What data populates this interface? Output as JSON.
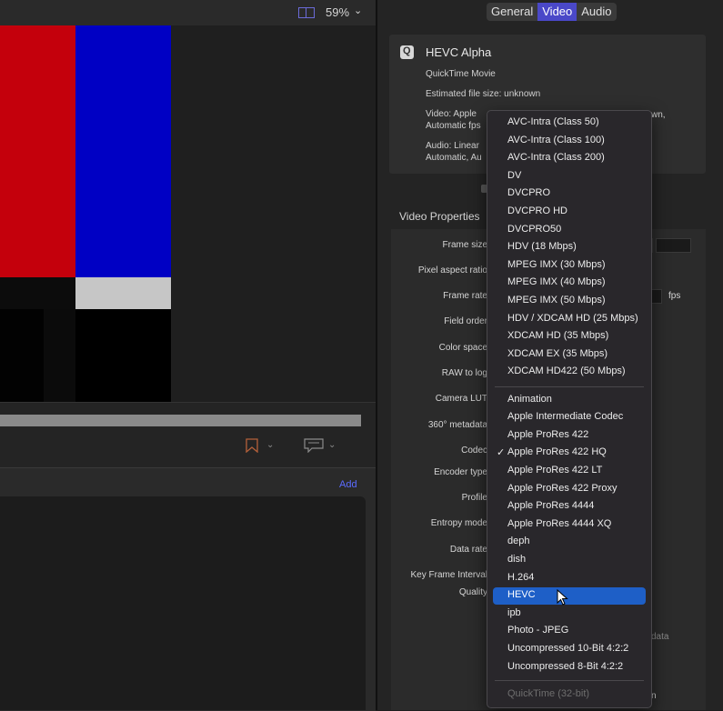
{
  "viewer": {
    "zoom_label": "59%",
    "zoom_chevron": "⌄",
    "add_label": "Add",
    "chev_glyph": "⌄"
  },
  "icons": {
    "zoom": "viewer-layout-icon",
    "bookmark": "bookmark-icon",
    "comment": "comment-icon",
    "app": "quicktime-icon",
    "cursor": "pointer-cursor-icon"
  },
  "colors": {
    "accent": "#4a48c8",
    "highlight": "#1e5fc7",
    "bar_red": "#c4000c",
    "bar_blue": "#0000c4",
    "link": "#5b6bff"
  },
  "tabs": [
    {
      "label": "General",
      "active": false
    },
    {
      "label": "Video",
      "active": true
    },
    {
      "label": "Audio",
      "active": false
    }
  ],
  "summary": {
    "title": "HEVC Alpha",
    "format": "QuickTime Movie",
    "file_size": "Estimated file size: unknown",
    "video_line1": "Video: Apple",
    "video_line1_tail": "wn,",
    "video_line2": "Automatic fps",
    "audio_line1": "Audio: Linear",
    "audio_line2": "Automatic, Au"
  },
  "video_properties": {
    "header": "Video Properties",
    "labels": {
      "frame_size": "Frame size",
      "pixel_aspect": "Pixel aspect ratio",
      "frame_rate": "Frame rate",
      "field_order": "Field order",
      "color_space": "Color space",
      "raw_to_log": "RAW to log",
      "camera_lut": "Camera LUT",
      "metadata_360": "360° metadata",
      "codec": "Codec",
      "encoder_type": "Encoder type",
      "profile": "Profile",
      "entropy_mode": "Entropy mode",
      "data_rate": "Data rate",
      "key_frame": "Key Frame Interval",
      "quality": "Quality"
    },
    "fps_unit": "fps",
    "data_tail": "data",
    "n_tail": "n"
  },
  "codec_menu": {
    "group1": [
      "AVC-Intra (Class 50)",
      "AVC-Intra (Class 100)",
      "AVC-Intra (Class 200)",
      "DV",
      "DVCPRO",
      "DVCPRO HD",
      "DVCPRO50",
      "HDV (18 Mbps)",
      "MPEG IMX (30 Mbps)",
      "MPEG IMX (40 Mbps)",
      "MPEG IMX (50 Mbps)",
      "HDV / XDCAM HD (25 Mbps)",
      "XDCAM HD (35 Mbps)",
      "XDCAM EX (35 Mbps)",
      "XDCAM HD422 (50 Mbps)"
    ],
    "group2": [
      "Animation",
      "Apple Intermediate Codec",
      "Apple ProRes 422",
      "Apple ProRes 422 HQ",
      "Apple ProRes 422 LT",
      "Apple ProRes 422 Proxy",
      "Apple ProRes 4444",
      "Apple ProRes 4444 XQ",
      "deph",
      "dish",
      "H.264",
      "HEVC",
      "ipb",
      "Photo - JPEG",
      "Uncompressed 10-Bit 4:2:2",
      "Uncompressed 8-Bit 4:2:2"
    ],
    "checked_item": "Apple ProRes 422 HQ",
    "check_glyph": "✓",
    "highlighted_item": "HEVC",
    "disabled_item": "QuickTime (32-bit)"
  }
}
